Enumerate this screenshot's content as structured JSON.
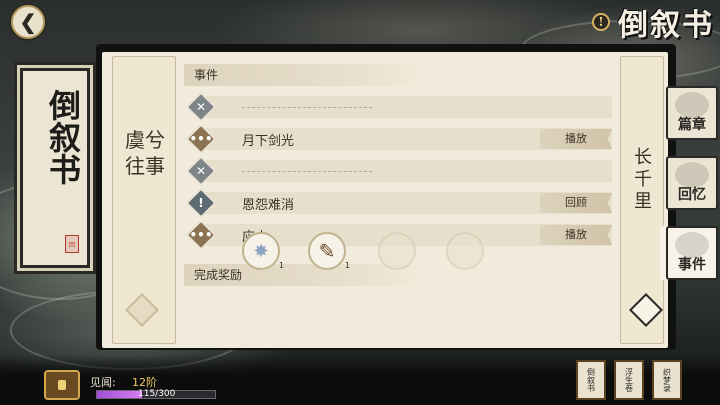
{
  "header": {
    "back_icon": "back-arrow-icon",
    "info_badge": "!",
    "title": "倒叙书"
  },
  "left_scroll": {
    "title": "倒叙书",
    "seal": "回"
  },
  "chapter": {
    "left_title": "虞兮往事",
    "right_title": "长千里"
  },
  "events": {
    "section_label": "事件",
    "items": [
      {
        "status": "locked",
        "icon": "close-icon",
        "title": "",
        "action": ""
      },
      {
        "status": "in-progress",
        "icon": "ellipsis-icon",
        "title": "月下剑光",
        "action": "播放"
      },
      {
        "status": "locked",
        "icon": "close-icon",
        "title": "",
        "action": ""
      },
      {
        "status": "notice",
        "icon": "exclamation-icon",
        "title": "恩怨难消",
        "action": "回顾"
      },
      {
        "status": "in-progress",
        "icon": "ellipsis-icon",
        "title": "应由",
        "action": "播放"
      }
    ]
  },
  "rewards": {
    "section_label": "完成奖励",
    "items": [
      {
        "icon": "snowflake-token-icon",
        "qty": "1"
      },
      {
        "icon": "brush-icon",
        "qty": "1"
      },
      {
        "icon": "empty-slot-icon",
        "qty": ""
      },
      {
        "icon": "empty-slot-icon",
        "qty": ""
      }
    ]
  },
  "side_tabs": [
    {
      "label": "篇章",
      "active": false
    },
    {
      "label": "回忆",
      "active": false
    },
    {
      "label": "事件",
      "active": true
    }
  ],
  "footer": {
    "xp_label": "见闻:",
    "xp_level": "12阶",
    "xp_progress": "115/300",
    "xp_fraction": 0.383,
    "books": [
      "倒叙书",
      "浮生卷",
      "织梦录"
    ]
  },
  "colors": {
    "panel_bg": "#f1ebdb",
    "accent_gold": "#d4b066",
    "xp_purple": "#c06ae8"
  }
}
